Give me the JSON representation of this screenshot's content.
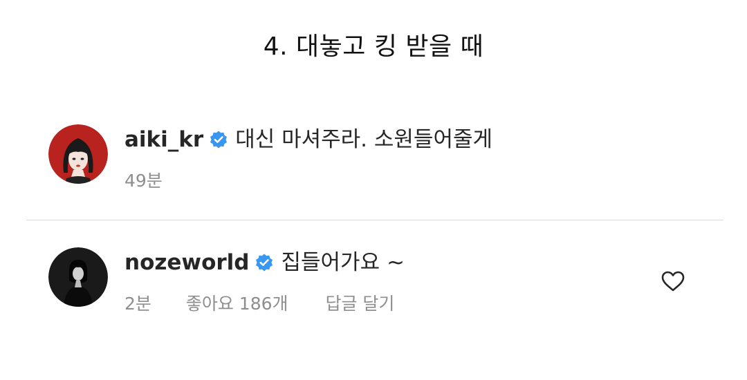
{
  "title": "4. 대놓고 킹 받을 때",
  "comments": [
    {
      "username": "aiki_kr",
      "verified": true,
      "text": "대신 마셔주라. 소원들어줄게",
      "time": "49분",
      "avatar_bg": "#b8231f"
    },
    {
      "username": "nozeworld",
      "verified": true,
      "text": "집들어가요 ~",
      "time": "2분",
      "likes": "좋아요 186개",
      "reply": "답글 달기",
      "avatar_bg": "#1a1a1a"
    }
  ],
  "colors": {
    "verified_blue": "#3897f0",
    "meta_gray": "#8e8e8e",
    "divider": "#dbdbdb"
  },
  "icons": {
    "verified": "verified-badge-icon",
    "like": "heart-icon"
  }
}
